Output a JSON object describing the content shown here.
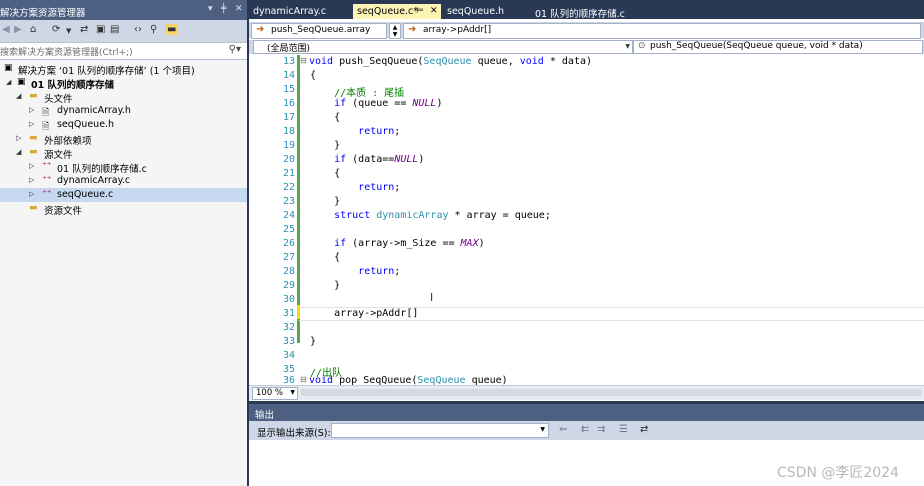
{
  "solution_explorer": {
    "title": "解决方案资源管理器",
    "title_controls": [
      "▾",
      "╪",
      "✕"
    ],
    "search_placeholder": "搜索解决方案资源管理器(Ctrl+;)",
    "tree": [
      {
        "label": "解决方案 ‘01 队列的顺序存储’ (1 个项目)",
        "icon": "▣",
        "arrow": "",
        "bold": false
      },
      {
        "label": "01 队列的顺序存储",
        "icon": "▣",
        "arrow": "◢",
        "bold": true
      },
      {
        "label": "头文件",
        "icon": "▬",
        "arrow": "◢",
        "bold": false
      },
      {
        "label": "dynamicArray.h",
        "icon": "🗎",
        "arrow": "▷",
        "bold": false
      },
      {
        "label": "seqQueue.h",
        "icon": "🗎",
        "arrow": "▷",
        "bold": false
      },
      {
        "label": "外部依赖项",
        "icon": "▬",
        "arrow": "▷",
        "bold": false
      },
      {
        "label": "源文件",
        "icon": "▬",
        "arrow": "◢",
        "bold": false
      },
      {
        "label": "01 队列的顺序存储.c",
        "icon": "⁺⁺",
        "arrow": "▷",
        "bold": false
      },
      {
        "label": "dynamicArray.c",
        "icon": "⁺⁺",
        "arrow": "▷",
        "bold": false
      },
      {
        "label": "seqQueue.c",
        "icon": "⁺⁺",
        "arrow": "▷",
        "bold": false
      },
      {
        "label": "资源文件",
        "icon": "▬",
        "arrow": "",
        "bold": false
      }
    ]
  },
  "tabs": [
    {
      "label": "dynamicArray.c",
      "active": false
    },
    {
      "label": "seqQueue.c*",
      "active": true,
      "pin": "⊨",
      "close": "✕"
    },
    {
      "label": "seqQueue.h",
      "active": false
    },
    {
      "label": "01 队列的顺序存储.c",
      "active": false
    }
  ],
  "nav": {
    "scope_combo": "push_SeqQueue.array",
    "member_combo": "array->pAddr[]",
    "global_scope": "(全局范围)",
    "function_combo": "push_SeqQueue(SeqQueue queue, void * data)"
  },
  "code": {
    "lines": [
      {
        "n": "13",
        "t": "void push_SeqQueue(SeqQueue queue, void * data)"
      },
      {
        "n": "14",
        "t": "{"
      },
      {
        "n": "15",
        "t": "    //本质 : 尾插"
      },
      {
        "n": "16",
        "t": "    if (queue == NULL)"
      },
      {
        "n": "17",
        "t": "    {"
      },
      {
        "n": "18",
        "t": "        return;"
      },
      {
        "n": "19",
        "t": "    }"
      },
      {
        "n": "20",
        "t": "    if (data==NULL)"
      },
      {
        "n": "21",
        "t": "    {"
      },
      {
        "n": "22",
        "t": "        return;"
      },
      {
        "n": "23",
        "t": "    }"
      },
      {
        "n": "24",
        "t": "    struct dynamicArray * array = queue;"
      },
      {
        "n": "25",
        "t": ""
      },
      {
        "n": "26",
        "t": "    if (array->m_Size == MAX)"
      },
      {
        "n": "27",
        "t": "    {"
      },
      {
        "n": "28",
        "t": "        return;"
      },
      {
        "n": "29",
        "t": "    }"
      },
      {
        "n": "30",
        "t": ""
      },
      {
        "n": "31",
        "t": "    array->pAddr[]"
      },
      {
        "n": "32",
        "t": ""
      },
      {
        "n": "33",
        "t": "}"
      },
      {
        "n": "34",
        "t": ""
      },
      {
        "n": "35",
        "t": "//出队"
      },
      {
        "n": "36",
        "t": "void pop_SeqQueue(SeqQueue queue)"
      }
    ],
    "zoom": "100 %"
  },
  "output": {
    "title": "输出",
    "source_label": "显示输出来源(S):",
    "source_value": ""
  },
  "watermark": "CSDN @李匠2024",
  "icons": {
    "search": "⌕",
    "back": "◀",
    "forward": "▶",
    "home": "⌂",
    "dropdown": "▼"
  }
}
